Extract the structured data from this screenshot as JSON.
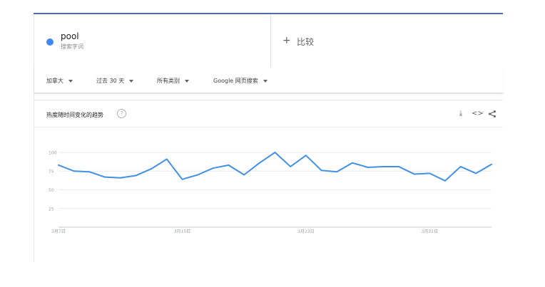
{
  "term": {
    "name": "pool",
    "subtitle": "搜索字词",
    "color": "#4285f4"
  },
  "compare": {
    "plus": "+",
    "label": "比较"
  },
  "filters": [
    {
      "label": "加拿大"
    },
    {
      "label": "过去 30 天"
    },
    {
      "label": "所有类别"
    },
    {
      "label": "Google 网页搜索"
    }
  ],
  "card": {
    "title": "热度随时间变化的趋势",
    "help": "?",
    "icons": [
      "download-icon",
      "embed-icon",
      "share-icon"
    ],
    "icon_glyphs": {
      "download": "⤓",
      "embed": "<>",
      "share": "<"
    }
  },
  "chart_data": {
    "type": "line",
    "title": "",
    "xlabel": "",
    "ylabel": "",
    "y_ticks": [
      100,
      75,
      50,
      25
    ],
    "ylim": [
      0,
      100
    ],
    "x_tick_labels": [
      "3月7日",
      "3月15日",
      "3月23日",
      "3月31日"
    ],
    "x_tick_indices": [
      0,
      8,
      16,
      24
    ],
    "grid": true,
    "series": [
      {
        "color": "#4290e6",
        "values": [
          83,
          75,
          74,
          67,
          66,
          69,
          78,
          91,
          64,
          70,
          79,
          83,
          70,
          86,
          100,
          81,
          96,
          76,
          74,
          86,
          80,
          81,
          81,
          71,
          72,
          62,
          81,
          72,
          84
        ]
      }
    ]
  }
}
